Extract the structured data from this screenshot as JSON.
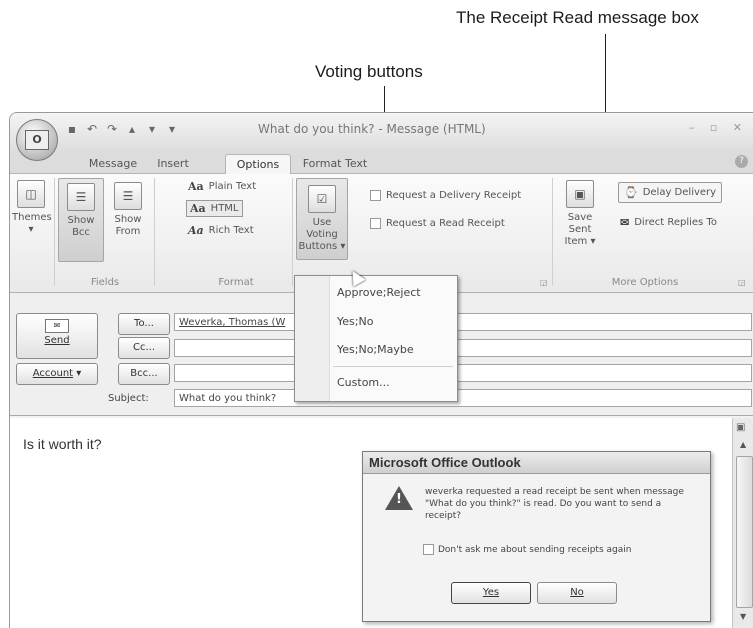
{
  "callouts": {
    "receipt": "The Receipt Read message box",
    "voting": "Voting buttons"
  },
  "window": {
    "title": "What do you think? - Message (HTML)",
    "office_logo": "O"
  },
  "tabs": [
    "Message",
    "Insert",
    "Options",
    "Format Text"
  ],
  "active_tab": "Options",
  "ribbon": {
    "themes": "Themes",
    "show_bcc": [
      "Show",
      "Bcc"
    ],
    "show_from": [
      "Show",
      "From"
    ],
    "fields_group": "Fields",
    "plain_text": "Plain Text",
    "html": "HTML",
    "rich_text": "Rich Text",
    "format_group": "Format",
    "use_voting": [
      "Use Voting",
      "Buttons"
    ],
    "delivery_receipt": "Request a Delivery Receipt",
    "read_receipt": "Request a Read Receipt",
    "save_sent": [
      "Save Sent",
      "Item"
    ],
    "delay_delivery": "Delay Delivery",
    "direct_replies": "Direct Replies To",
    "more_options_group": "More Options"
  },
  "voting_menu": [
    "Approve;Reject",
    "Yes;No",
    "Yes;No;Maybe",
    "Custom..."
  ],
  "envelope": {
    "send": "Send",
    "to_btn": "To...",
    "cc_btn": "Cc...",
    "bcc_btn": "Bcc...",
    "account_btn": "Account",
    "to_value": "Weverka, Thomas (W",
    "subject_label": "Subject:",
    "subject_value": "What do you think?"
  },
  "body_text": "Is it worth it?",
  "dialog": {
    "title": "Microsoft Office Outlook",
    "message": "weverka requested a read receipt be sent when message \"What do you think?\" is read. Do you want to send a receipt?",
    "checkbox": "Don't ask me about sending receipts again",
    "yes": "Yes",
    "no": "No"
  }
}
